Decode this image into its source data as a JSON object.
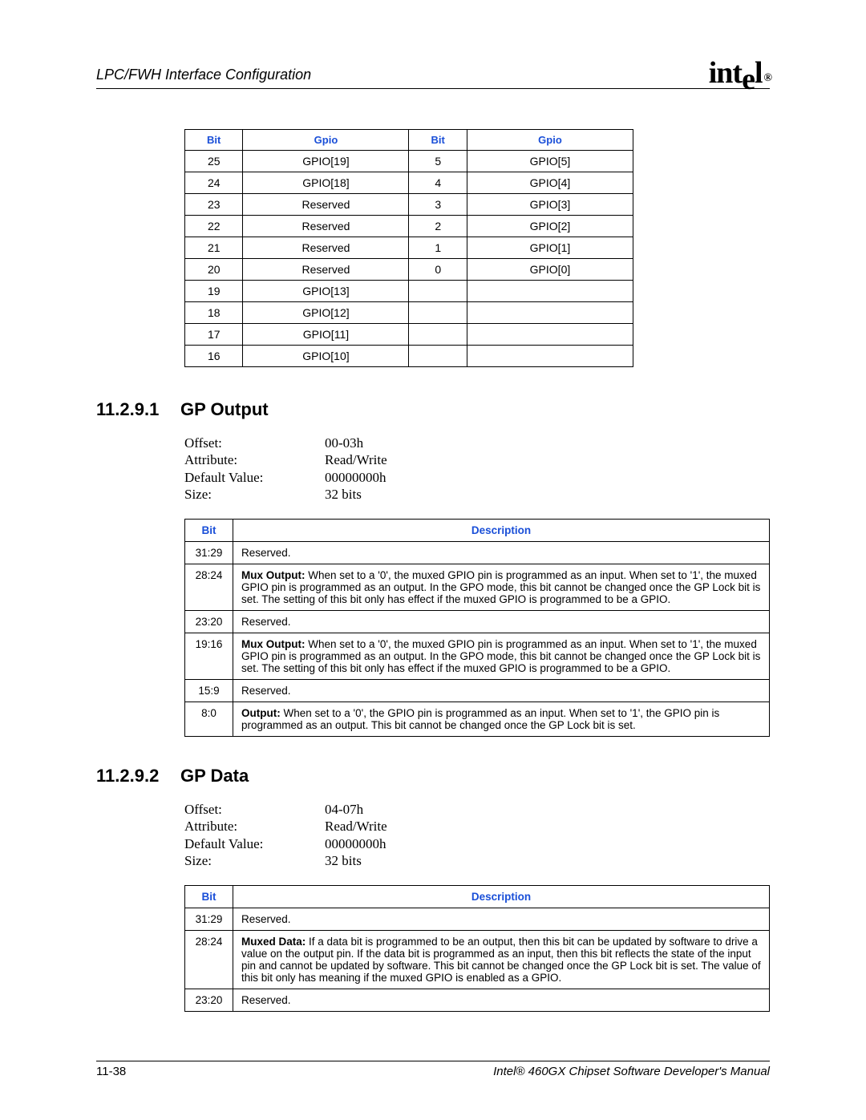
{
  "header": {
    "title": "LPC/FWH Interface Configuration",
    "logo_text": "intel",
    "logo_reg": "®"
  },
  "bit_gpio_table": {
    "headers": [
      "Bit",
      "Gpio",
      "Bit",
      "Gpio"
    ],
    "rows": [
      [
        "25",
        "GPIO[19]",
        "5",
        "GPIO[5]"
      ],
      [
        "24",
        "GPIO[18]",
        "4",
        "GPIO[4]"
      ],
      [
        "23",
        "Reserved",
        "3",
        "GPIO[3]"
      ],
      [
        "22",
        "Reserved",
        "2",
        "GPIO[2]"
      ],
      [
        "21",
        "Reserved",
        "1",
        "GPIO[1]"
      ],
      [
        "20",
        "Reserved",
        "0",
        "GPIO[0]"
      ],
      [
        "19",
        "GPIO[13]",
        "",
        ""
      ],
      [
        "18",
        "GPIO[12]",
        "",
        ""
      ],
      [
        "17",
        "GPIO[11]",
        "",
        ""
      ],
      [
        "16",
        "GPIO[10]",
        "",
        ""
      ]
    ]
  },
  "section1": {
    "number": "11.2.9.1",
    "title": "GP Output",
    "attrs": [
      {
        "label": "Offset:",
        "value": "00-03h"
      },
      {
        "label": "Attribute:",
        "value": "Read/Write"
      },
      {
        "label": "Default Value:",
        "value": "00000000h"
      },
      {
        "label": "Size:",
        "value": "32 bits"
      }
    ],
    "desc_headers": [
      "Bit",
      "Description"
    ],
    "desc_rows": [
      {
        "bit": "31:29",
        "bold": "",
        "text": "Reserved."
      },
      {
        "bit": "28:24",
        "bold": "Mux Output:",
        "text": " When set to a '0', the muxed GPIO pin is programmed as an input. When set to '1', the muxed GPIO pin is programmed as an output. In the GPO mode, this bit cannot be changed once the GP Lock bit is set. The setting of this bit only has effect if the muxed GPIO is programmed to be a GPIO."
      },
      {
        "bit": "23:20",
        "bold": "",
        "text": "Reserved."
      },
      {
        "bit": "19:16",
        "bold": "Mux Output:",
        "text": " When set to a '0', the muxed GPIO pin is programmed as an input. When set to '1', the muxed GPIO pin is programmed as an output. In the GPO mode, this bit cannot be changed once the GP Lock bit is set. The setting of this bit only has effect if the muxed GPIO is programmed to be a GPIO."
      },
      {
        "bit": "15:9",
        "bold": "",
        "text": "Reserved."
      },
      {
        "bit": "8:0",
        "bold": "Output:",
        "text": " When set to a '0', the GPIO pin is programmed as an input. When set to '1', the GPIO pin is programmed as an output. This bit cannot be changed once the GP Lock bit is set."
      }
    ]
  },
  "section2": {
    "number": "11.2.9.2",
    "title": "GP Data",
    "attrs": [
      {
        "label": "Offset:",
        "value": "04-07h"
      },
      {
        "label": "Attribute:",
        "value": "Read/Write"
      },
      {
        "label": "Default Value:",
        "value": "00000000h"
      },
      {
        "label": "Size:",
        "value": "32 bits"
      }
    ],
    "desc_headers": [
      "Bit",
      "Description"
    ],
    "desc_rows": [
      {
        "bit": "31:29",
        "bold": "",
        "text": "Reserved."
      },
      {
        "bit": "28:24",
        "bold": "Muxed Data:",
        "text": " If a data bit is programmed to be an output, then this bit can be updated by software to drive a value on the output pin. If the data bit is programmed as an input, then this bit reflects the state of the input pin and cannot be updated by software. This bit cannot be changed once the GP Lock bit is set. The value of this bit only has meaning if the muxed GPIO is enabled as a GPIO."
      },
      {
        "bit": "23:20",
        "bold": "",
        "text": "Reserved."
      }
    ]
  },
  "footer": {
    "left": "11-38",
    "right": "Intel® 460GX Chipset Software Developer's Manual"
  }
}
